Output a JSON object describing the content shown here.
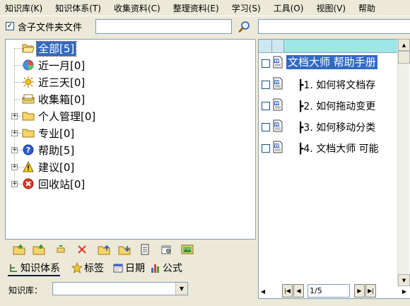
{
  "menu": {
    "items": [
      {
        "label": "知识库(K)"
      },
      {
        "label": "知识体系(T)"
      },
      {
        "label": "收集资料(C)"
      },
      {
        "label": "整理资料(E)"
      },
      {
        "label": "学习(S)"
      },
      {
        "label": "工具(O)"
      },
      {
        "label": "视图(V)"
      },
      {
        "label": "帮助"
      }
    ]
  },
  "filter": {
    "include_subfolders_checked": "✓",
    "include_subfolders_label": "含子文件夹文件",
    "search_value": ""
  },
  "tree": {
    "items": [
      {
        "label": "全部[5]",
        "icon": "folder-open-icon",
        "selected": true
      },
      {
        "label": "近一月[0]",
        "icon": "pie-chart-icon"
      },
      {
        "label": "近三天[0]",
        "icon": "sun-icon"
      },
      {
        "label": "收集箱[0]",
        "icon": "inbox-icon"
      },
      {
        "label": "个人管理[0]",
        "icon": "folder-icon",
        "expandable": true
      },
      {
        "label": "专业[0]",
        "icon": "folder-icon",
        "expandable": true
      },
      {
        "label": "帮助[5]",
        "icon": "help-icon",
        "expandable": true
      },
      {
        "label": "建议[0]",
        "icon": "warning-icon",
        "expandable": true
      },
      {
        "label": "回收站[0]",
        "icon": "recycle-icon",
        "expandable": true
      }
    ]
  },
  "tabs": [
    {
      "label": "知识体系",
      "icon": "tree-icon",
      "active": true
    },
    {
      "label": "标签",
      "icon": "star-icon"
    },
    {
      "label": "日期",
      "icon": "calendar-icon"
    },
    {
      "label": "公式",
      "icon": "bar-chart-icon"
    }
  ],
  "knowledge_base": {
    "label": "知识库：",
    "value": ""
  },
  "documents": {
    "items": [
      {
        "title": "文档大师 帮助手册"
      },
      {
        "title": "┣1. 如何将文档存"
      },
      {
        "title": "┣2. 如何拖动变更"
      },
      {
        "title": "┣3. 如何移动分类"
      },
      {
        "title": "┣4. 文档大师 可能"
      }
    ]
  },
  "pager": {
    "page_value": "1/5"
  },
  "colors": {
    "selection": "#316ac5",
    "header_cyan": "#9fe6e6",
    "window_bg": "#ece9d8"
  }
}
